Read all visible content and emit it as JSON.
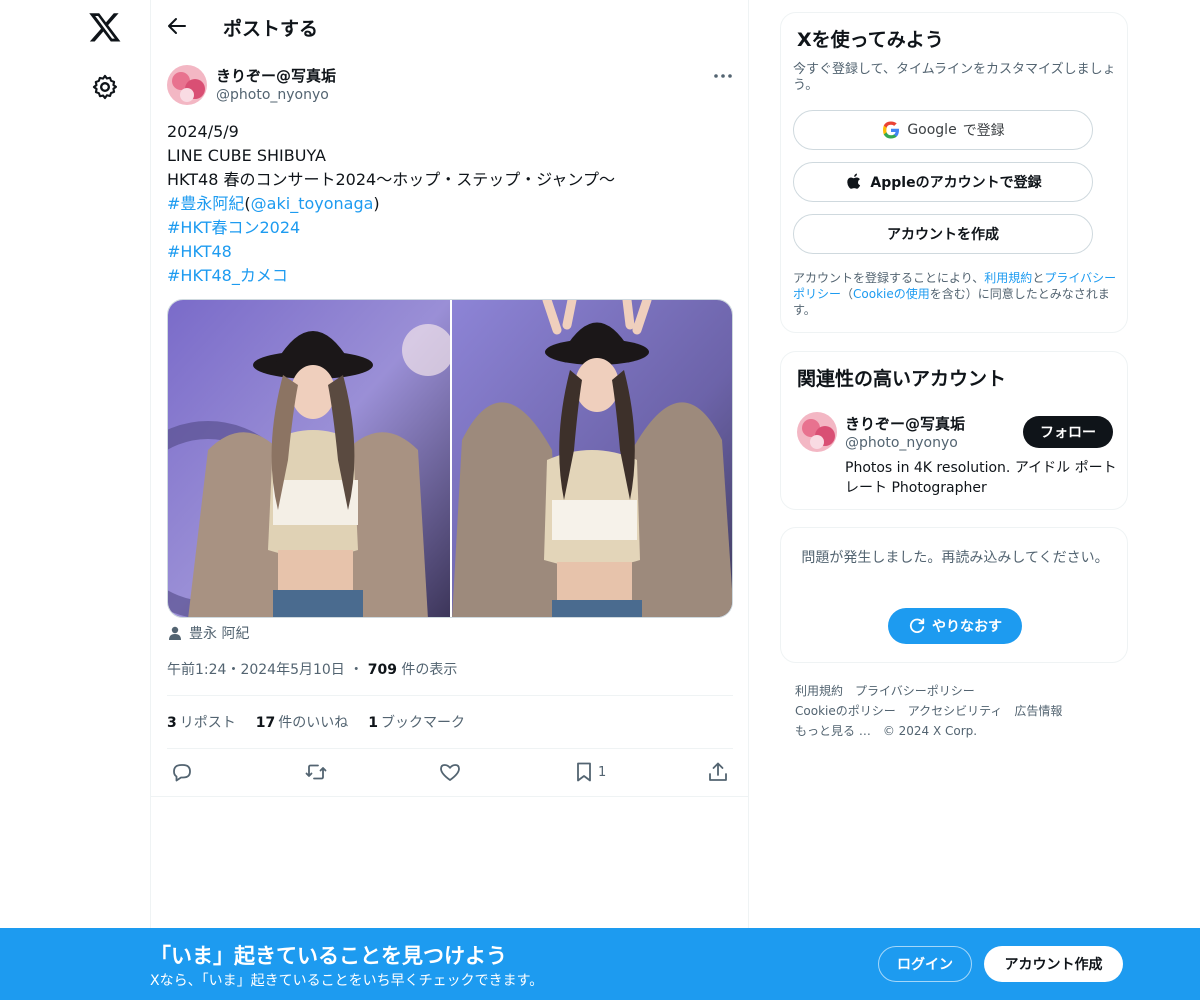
{
  "nav": {
    "logo_icon": "x-logo-icon",
    "settings_icon": "gear-icon"
  },
  "header": {
    "back_icon": "arrow-left-icon",
    "title": "ポストする"
  },
  "post": {
    "author_name": "きりぞー@写真垢",
    "author_handle": "@photo_nyonyo",
    "more_icon": "more-horizontal-icon",
    "text_lines": {
      "date": "2024/5/9",
      "venue": "LINE CUBE SHIBUYA",
      "event": "HKT48 春のコンサート2024〜ホップ・ステップ・ジャンプ〜",
      "hashtag_name": "#豊永阿紀",
      "paren_open": "(",
      "mention": "@aki_toyonaga",
      "paren_close": ")",
      "hashtag_2": "#HKT春コン2024",
      "hashtag_3": "#HKT48",
      "hashtag_4": "#HKT48_カメコ"
    },
    "tagged_person": "豊永 阿紀",
    "time": "午前1:24",
    "separator": "・",
    "date": "2024年5月10日",
    "separator_2": "・",
    "views_count": "709",
    "views_label": "件の表示",
    "stats": {
      "reposts_count": "3",
      "reposts_label": "リポスト",
      "likes_count": "17",
      "likes_label": "件のいいね",
      "bookmarks_count": "1",
      "bookmarks_label": "ブックマーク"
    },
    "actions": {
      "reply_icon": "reply-icon",
      "repost_icon": "repost-icon",
      "like_icon": "heart-icon",
      "bookmark_icon": "bookmark-icon",
      "bookmark_count": "1",
      "share_icon": "share-icon"
    }
  },
  "sidebar": {
    "signup": {
      "title": "Xを使ってみよう",
      "subtitle": "今すぐ登録して、タイムラインをカスタマイズしましょう。",
      "google_brand": "Google",
      "google_suffix": "で登録",
      "apple_label": "Appleのアカウントで登録",
      "create_label": "アカウントを作成",
      "legal_pre": "アカウントを登録することにより、",
      "legal_terms": "利用規約",
      "legal_and": "と",
      "legal_privacy": "プライバシーポリシー",
      "legal_paren_open": "（",
      "legal_cookie": "Cookieの使用",
      "legal_post": "を含む）に同意したとみなされます。"
    },
    "relevant": {
      "title": "関連性の高いアカウント",
      "name": "きりぞー@写真垢",
      "handle": "@photo_nyonyo",
      "follow_label": "フォロー",
      "bio": "Photos in 4K resolution. アイドル ポートレート Photographer"
    },
    "error": {
      "message": "問題が発生しました。再読み込みしてください。",
      "retry_label": "やりなおす"
    },
    "footer": {
      "terms": "利用規約",
      "privacy": "プライバシーポリシー",
      "cookie": "Cookieのポリシー",
      "accessibility": "アクセシビリティ",
      "ads": "広告情報",
      "more": "もっと見る …",
      "copyright": "© 2024 X Corp."
    }
  },
  "banner": {
    "title": "「いま」起きていることを見つけよう",
    "subtitle": "Xなら、「いま」起きていることをいち早くチェックできます。",
    "login_label": "ログイン",
    "signup_label": "アカウント作成"
  },
  "colors": {
    "accent": "#1d9bf0",
    "text": "#0f1419",
    "muted": "#536471",
    "border": "#eff3f4"
  }
}
